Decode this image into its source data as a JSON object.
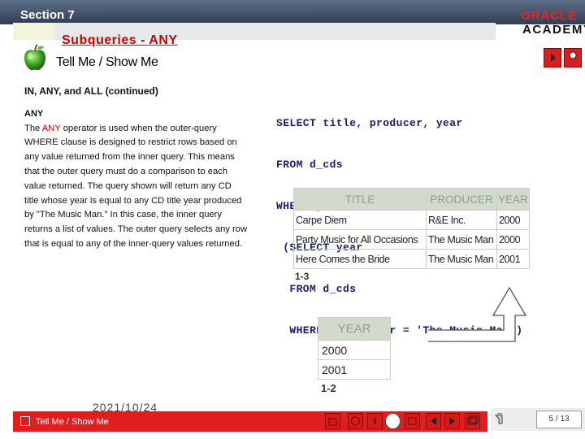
{
  "header": {
    "section": "Section 7",
    "subtitle": "Subqueries - ANY",
    "logo_line1": "ORACLE",
    "logo_line2": "ACADEMY",
    "tell_me": "Tell Me / Show Me",
    "accent_color": "#cc0000"
  },
  "left_panel": {
    "heading": "IN, ANY, and ALL (continued)",
    "any_heading": "ANY",
    "para_prefix": "The ",
    "para_keyword": "ANY",
    "para_rest": " operator is used when the outer-query WHERE clause is designed to restrict rows based on any value returned from the inner query. This means that the outer query must do a comparison to each value returned. The query shown will return any CD title whose year is equal to any CD title year produced by \"The Music Man.\" In this case, the inner query returns a list of values. The outer query selects any row that is equal to any of the inner-query values returned."
  },
  "sql": {
    "lines": [
      "SELECT title, producer, year",
      "FROM d_cds",
      "WHERE year = ANY",
      " (SELECT year",
      "  FROM d_cds",
      "  WHERE   producer = 'The Music Man')"
    ]
  },
  "table1": {
    "headers": [
      "TITLE",
      "PRODUCER",
      "YEAR"
    ],
    "rows": [
      [
        "Carpe Diem",
        "R&E Inc.",
        "2000"
      ],
      [
        "Party Music for All Occasions",
        "The Music Man",
        "2000"
      ],
      [
        "Here Comes the Bride",
        "The Music Man",
        "2001"
      ]
    ],
    "caption": "1-3"
  },
  "table2": {
    "headers": [
      "YEAR"
    ],
    "rows": [
      [
        "2000"
      ],
      [
        "2001"
      ]
    ],
    "caption": "1-2"
  },
  "footer": {
    "date": "2021/10/24",
    "nav_label": "Tell Me / Show Me",
    "page": "5 / 13"
  }
}
